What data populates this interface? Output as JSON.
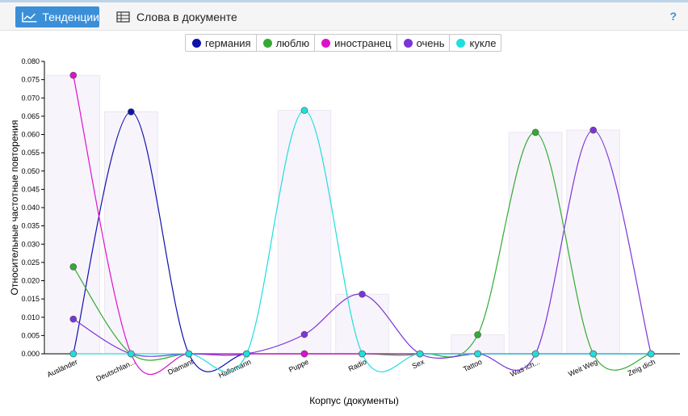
{
  "toolbar": {
    "tabs": [
      {
        "label": "Тенденции",
        "icon": "line-chart-icon",
        "active": true
      },
      {
        "label": "Слова в документе",
        "icon": "table-icon",
        "active": false
      }
    ],
    "help_label": "?"
  },
  "colors": {
    "accent": "#3a8fd8"
  },
  "chart_data": {
    "type": "line",
    "xlabel": "Корпус (документы)",
    "ylabel": "Относительные частотные повторения",
    "ylim": [
      0,
      0.08
    ],
    "yticks": [
      "0.000",
      "0.005",
      "0.010",
      "0.015",
      "0.020",
      "0.025",
      "0.030",
      "0.035",
      "0.040",
      "0.045",
      "0.050",
      "0.055",
      "0.060",
      "0.065",
      "0.070",
      "0.075",
      "0.080"
    ],
    "categories": [
      "Ausländer",
      "Deutschlan...",
      "Diamant",
      "Hallomann",
      "Puppe",
      "Radio",
      "Sex",
      "Tattoo",
      "Was ich...",
      "Weit Weg",
      "Zeig dich"
    ],
    "legend_position": "top-center",
    "series": [
      {
        "name": "германия",
        "color": "#1010b0",
        "values": [
          0,
          0.0662,
          0,
          0,
          0,
          0,
          0,
          0,
          0,
          0,
          0
        ]
      },
      {
        "name": "люблю",
        "color": "#33aa33",
        "values": [
          0.0238,
          0,
          0,
          0,
          0,
          0,
          0,
          0.0052,
          0.0606,
          0,
          0
        ]
      },
      {
        "name": "иностранец",
        "color": "#dd11cc",
        "values": [
          0.0762,
          0,
          0,
          0,
          0,
          0,
          0,
          0,
          0,
          0,
          0
        ]
      },
      {
        "name": "очень",
        "color": "#7a35d8",
        "values": [
          0.0095,
          0,
          0,
          0,
          0.0053,
          0.0163,
          0,
          0,
          0,
          0.0612,
          0
        ]
      },
      {
        "name": "кукле",
        "color": "#22dddd",
        "values": [
          0,
          0,
          0,
          0,
          0.0666,
          0,
          0,
          0,
          0,
          0,
          0
        ]
      }
    ]
  }
}
